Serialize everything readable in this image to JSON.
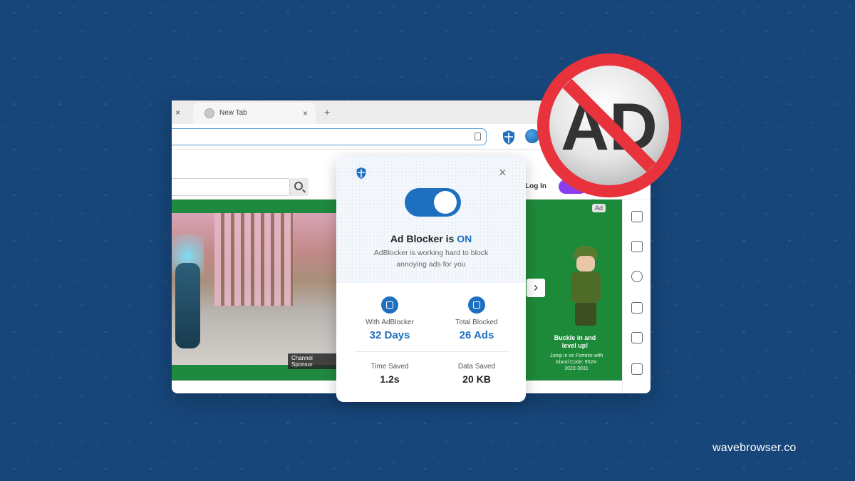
{
  "browser": {
    "tab_title": "New Tab",
    "tab_close_glyph": "×",
    "new_tab_glyph": "+",
    "site_login": "Log In",
    "ad_badge": "Ad",
    "ad_heading": "Buckle in and level up!",
    "ad_body": "Jump in on Fortnite with Island Code: 9524-2023-3031",
    "video_label": "Channel Sponsor",
    "next_glyph": "›"
  },
  "popup": {
    "close_glyph": "×",
    "status_prefix": "Ad Blocker is ",
    "status_value": "ON",
    "description": "AdBlocker is working hard to block annoying ads for you",
    "toggle_on": true,
    "stats": [
      {
        "label": "With AdBlocker",
        "value": "32 Days"
      },
      {
        "label": "Total Blocked",
        "value": "26 Ads"
      },
      {
        "label": "Time Saved",
        "value": "1.2s"
      },
      {
        "label": "Data Saved",
        "value": "20 KB"
      }
    ]
  },
  "sign": {
    "text": "AD"
  },
  "footer": {
    "brand": "wavebrowser.co"
  },
  "colors": {
    "background": "#17467a",
    "accent": "#1f6fc0",
    "sign_red": "#e8323c",
    "ad_green": "#1d8a3a"
  },
  "icons": [
    "shield-icon",
    "globe-icon",
    "bookmark-icon",
    "search-icon",
    "calendar-icon",
    "block-icon",
    "close-icon",
    "chevron-right-icon"
  ]
}
